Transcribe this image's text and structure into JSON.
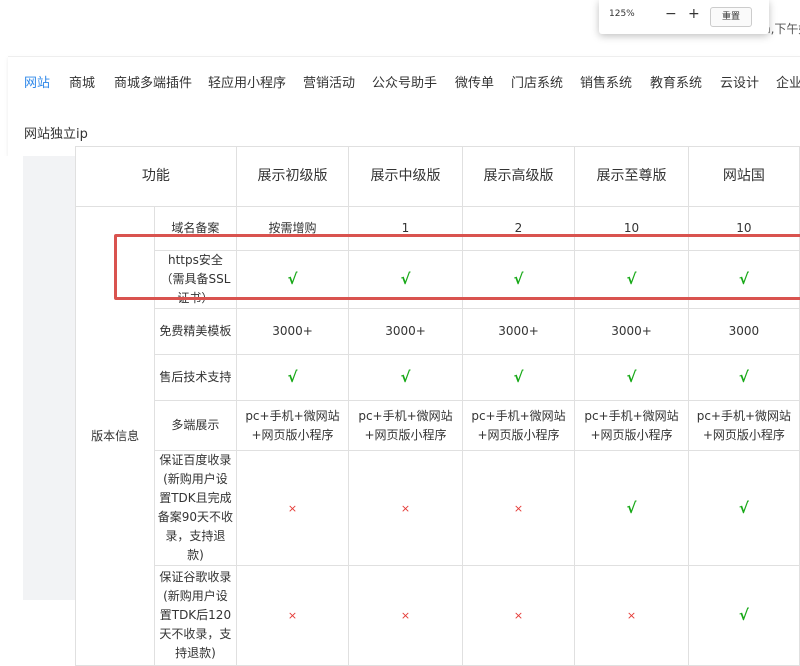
{
  "top_right_text": "n,下午好",
  "zoom": {
    "percent": "125%",
    "minus": "−",
    "plus": "+",
    "reset_label": "重置"
  },
  "nav": {
    "items": [
      "网站",
      "商城",
      "商城多端插件",
      "轻应用小程序",
      "营销活动",
      "公众号助手",
      "微传单",
      "门店系统",
      "销售系统",
      "教育系统",
      "云设计",
      "企业"
    ],
    "active_index": 0,
    "second_row": [
      "网站独立ip"
    ]
  },
  "table": {
    "header_label": "功能",
    "group_label": "版本信息",
    "columns": [
      "展示初级版",
      "展示中级版",
      "展示高级版",
      "展示至尊版",
      "网站国"
    ],
    "rows": [
      {
        "feature": "域名备案",
        "values": [
          "按需增购",
          "1",
          "2",
          "10",
          "10"
        ]
      },
      {
        "feature": "https安全（需具备SSL证书）",
        "values": [
          "√",
          "√",
          "√",
          "√",
          "√"
        ]
      },
      {
        "feature": "免费精美模板",
        "values": [
          "3000+",
          "3000+",
          "3000+",
          "3000+",
          "3000"
        ]
      },
      {
        "feature": "售后技术支持",
        "values": [
          "√",
          "√",
          "√",
          "√",
          "√"
        ]
      },
      {
        "feature": "多端展示",
        "values": [
          "pc+手机+微网站+网页版小程序",
          "pc+手机+微网站+网页版小程序",
          "pc+手机+微网站+网页版小程序",
          "pc+手机+微网站+网页版小程序",
          "pc+手机+微网站+网页版小程序"
        ]
      },
      {
        "feature": "保证百度收录(新购用户设置TDK且完成备案90天不收录，支持退款)",
        "values": [
          "×",
          "×",
          "×",
          "√",
          "√"
        ]
      },
      {
        "feature": "保证谷歌收录(新购用户设置TDK后120天不收录，支持退款)",
        "values": [
          "×",
          "×",
          "×",
          "×",
          "√"
        ]
      }
    ]
  },
  "colors": {
    "accent": "#2f88e9",
    "check": "#18a918",
    "cross": "#e53935",
    "highlight": "#d9534f"
  }
}
